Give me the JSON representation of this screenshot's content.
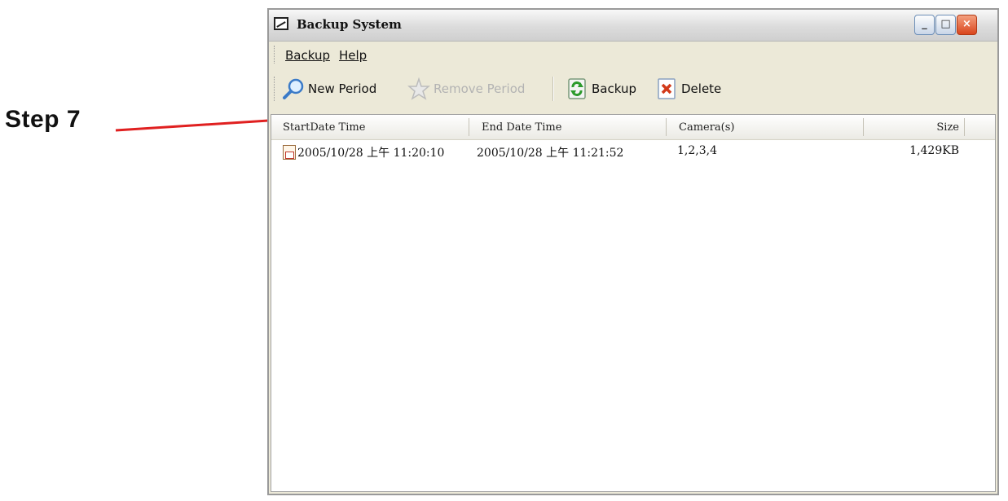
{
  "annotation": {
    "label": "Step 7"
  },
  "window": {
    "title": "Backup System",
    "controls": {
      "minimize": "_",
      "maximize": "□",
      "close": "×"
    }
  },
  "menu": {
    "items": [
      {
        "label": "Backup",
        "accelerator": "B"
      },
      {
        "label": "Help",
        "accelerator": "H"
      }
    ]
  },
  "toolbar": {
    "buttons": [
      {
        "label": "New Period",
        "icon": "magnifier-icon",
        "enabled": true
      },
      {
        "label": "Remove Period",
        "icon": "star-icon",
        "enabled": false
      },
      {
        "label": "Backup",
        "icon": "refresh-icon",
        "enabled": true
      },
      {
        "label": "Delete",
        "icon": "delete-icon",
        "enabled": true
      }
    ]
  },
  "list": {
    "columns": [
      "StartDate Time",
      "End Date Time",
      "Camera(s)",
      "Size"
    ],
    "rows": [
      {
        "start": "2005/10/28 上午 11:20:10",
        "end": "2005/10/28 上午 11:21:52",
        "cameras": "1,2,3,4",
        "size": "1,429KB"
      }
    ]
  },
  "colors": {
    "annotation_line": "#e02020",
    "close_button": "#d9461e"
  }
}
